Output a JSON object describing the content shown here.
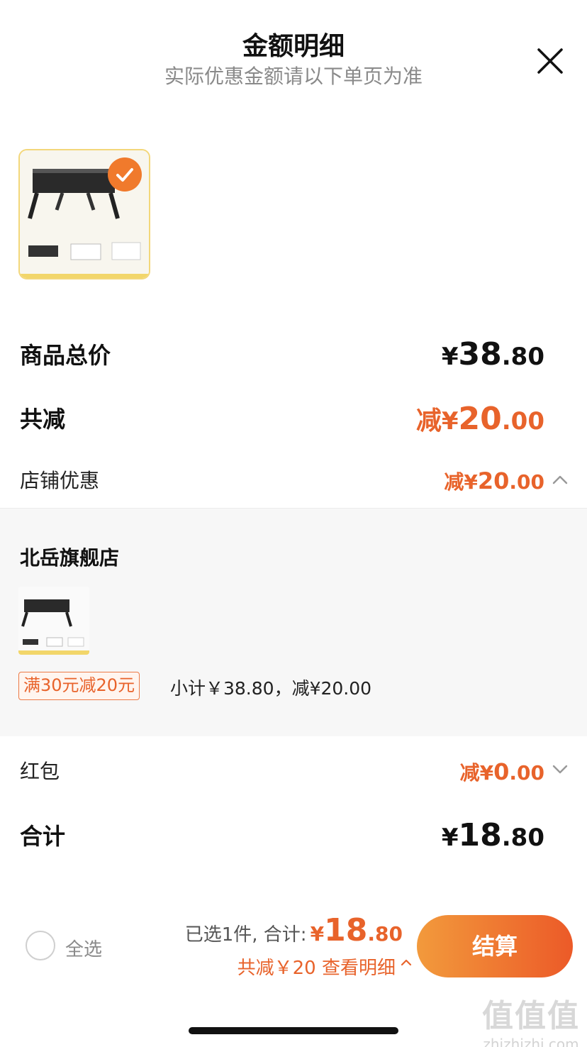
{
  "header": {
    "title": "金额明细",
    "subtitle": "实际优惠金额请以下单页为准"
  },
  "rows": {
    "goods_total": {
      "label": "商品总价",
      "yen": "¥",
      "int": "38",
      "dec": ".80"
    },
    "total_reduce": {
      "label": "共减",
      "prefix": "减",
      "yen": "¥",
      "int": "20",
      "dec": ".00"
    },
    "store_discount": {
      "label": "店铺优惠",
      "prefix": "减",
      "yen": "¥",
      "int": "20",
      "dec": ".00"
    },
    "red_packet": {
      "label": "红包",
      "prefix": "减",
      "yen": "¥",
      "int": "0",
      "dec": ".00"
    },
    "sum": {
      "label": "合计",
      "yen": "¥",
      "int": "18",
      "dec": ".80"
    }
  },
  "store": {
    "name": "北岳旗舰店",
    "promo_tag": "满30元减20元",
    "promo_text": "小计￥38.80，减¥20.00"
  },
  "bottom": {
    "select_all": "全选",
    "selected_text": "已选1件, 合计:",
    "yen": "¥",
    "int": "18",
    "dec": ".80",
    "reduce_text": "共减￥20 查看明细",
    "checkout": "结算"
  },
  "watermark": {
    "logo": "值值值",
    "domain": "zhizhizhi.com"
  },
  "colors": {
    "accent": "#e8632b",
    "checkout_start": "#f29a3c",
    "checkout_end": "#ec5a28",
    "panel_bg": "#f7f7f7"
  }
}
